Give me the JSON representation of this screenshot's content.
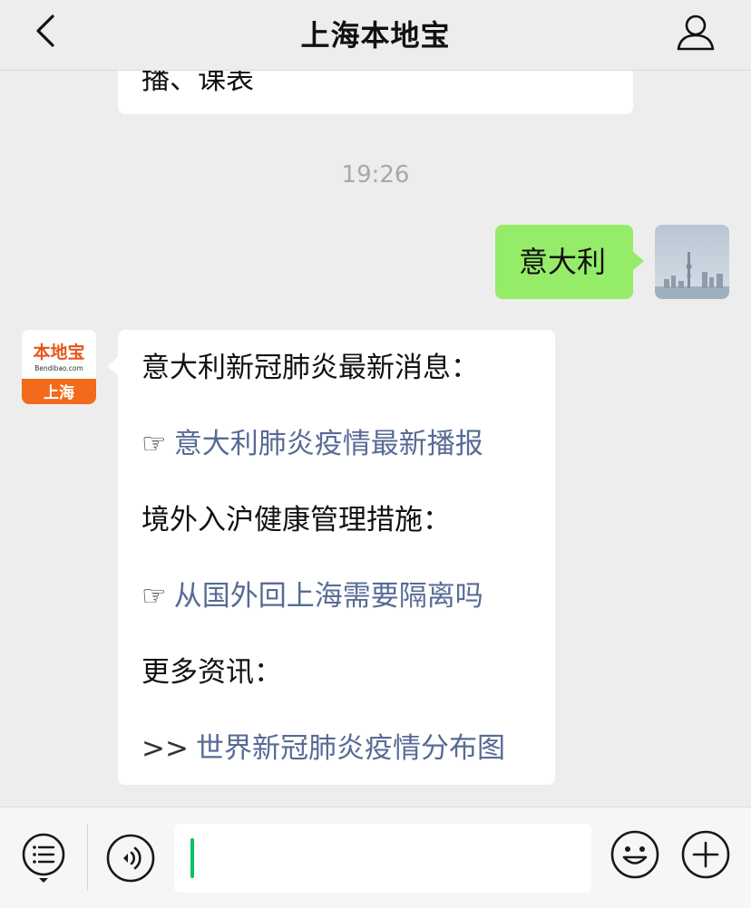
{
  "header": {
    "title": "上海本地宝",
    "back_icon": "chevron-left-icon",
    "profile_icon": "person-icon"
  },
  "chat": {
    "previous_message_tail": "播、课表",
    "timestamp": "19:26",
    "outgoing": {
      "text": "意大利"
    },
    "incoming": {
      "avatar_brand": "本地宝",
      "avatar_domain": "Bendibao.com",
      "avatar_city": "上海",
      "lines": [
        {
          "text": "意大利新冠肺炎最新消息："
        },
        {
          "prefix": "☞",
          "link": "意大利肺炎疫情最新播报"
        },
        {
          "text": "境外入沪健康管理措施："
        },
        {
          "prefix": "☞",
          "link": "从国外回上海需要隔离吗"
        },
        {
          "text": "更多资讯："
        },
        {
          "prefix": ">>",
          "link": "世界新冠肺炎疫情分布图"
        }
      ]
    }
  },
  "input_bar": {
    "menu_icon": "menu-list-icon",
    "voice_icon": "voice-icon",
    "emoji_icon": "emoji-icon",
    "plus_icon": "plus-icon",
    "input_value": ""
  },
  "colors": {
    "background": "#ededed",
    "outgoing_bubble": "#95ec69",
    "link": "#576b95",
    "cursor": "#07c160",
    "brand_orange": "#f26a1b"
  }
}
